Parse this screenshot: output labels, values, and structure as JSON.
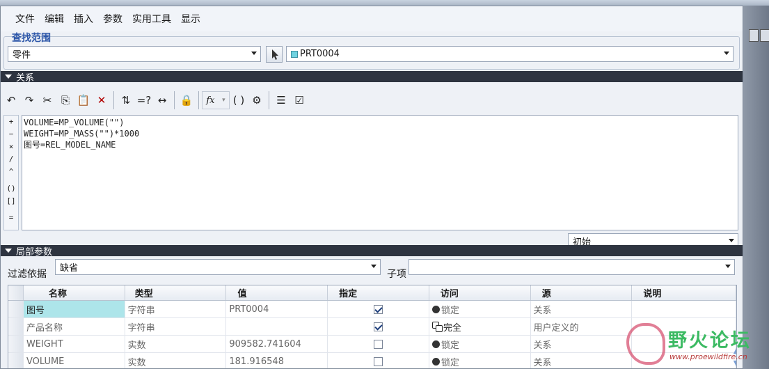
{
  "menu": [
    "文件",
    "编辑",
    "插入",
    "参数",
    "实用工具",
    "显示"
  ],
  "scope": {
    "title": "查找范围",
    "type_value": "零件",
    "model_value": "PRT0004"
  },
  "relations": {
    "title": "关系",
    "lines": [
      "VOLUME=MP_VOLUME(\"\")",
      "WEIGHT=MP_MASS(\"\")*1000",
      "图号=REL_MODEL_NAME"
    ],
    "operators": [
      "+",
      "−",
      "×",
      "/",
      "^",
      "()",
      "[]",
      "="
    ],
    "state_value": "初始",
    "toolbar_icons": [
      "undo-icon",
      "redo-icon",
      "cut-icon",
      "copy-icon",
      "paste-icon",
      "delete-icon",
      "verify-icon",
      "evaluate-icon",
      "units-icon",
      "lock-icon",
      "function-icon",
      "brackets-icon",
      "parameter-icon",
      "sort-icon",
      "check-icon"
    ]
  },
  "local_params": {
    "title": "局部参数",
    "filter_label": "过滤依据",
    "filter_value": "缺省",
    "subitem_label": "子项",
    "subitem_value": "",
    "columns": [
      "名称",
      "类型",
      "值",
      "指定",
      "访问",
      "源",
      "说明"
    ],
    "rows": [
      {
        "name": "图号",
        "type": "字符串",
        "value": "PRT0004",
        "designated": true,
        "access": "锁定",
        "access_icon": "lock",
        "source": "关系",
        "desc": ""
      },
      {
        "name": "产品名称",
        "type": "字符串",
        "value": "",
        "designated": true,
        "access": "完全",
        "access_icon": "unlock",
        "source": "用户定义的",
        "desc": ""
      },
      {
        "name": "WEIGHT",
        "type": "实数",
        "value": "909582.741604",
        "designated": false,
        "access": "锁定",
        "access_icon": "lock",
        "source": "关系",
        "desc": ""
      },
      {
        "name": "VOLUME",
        "type": "实数",
        "value": "181.916548",
        "designated": false,
        "access": "锁定",
        "access_icon": "lock",
        "source": "关系",
        "desc": ""
      }
    ]
  },
  "watermark": {
    "text": "野火论坛",
    "url": "www.proewildfire.cn"
  },
  "colors": {
    "section_bar": "#2e3440",
    "group_title": "#2a55a8",
    "selected_cell": "#ade5ea"
  }
}
